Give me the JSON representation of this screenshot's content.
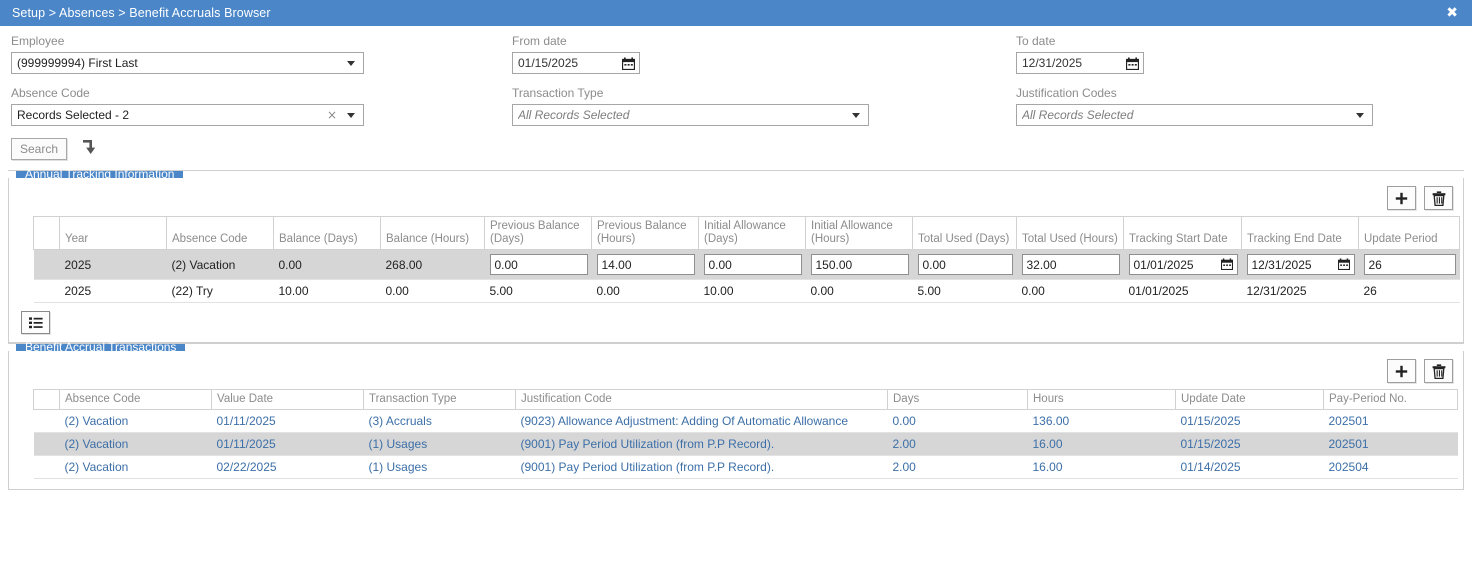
{
  "titlebar": {
    "breadcrumb": "Setup > Absences > Benefit Accruals Browser",
    "close_label": "✖"
  },
  "filters": {
    "employee": {
      "label": "Employee",
      "value": "(999999994) First Last"
    },
    "absence_code": {
      "label": "Absence Code",
      "value": "Records Selected - 2",
      "clear_label": "×"
    },
    "from_date": {
      "label": "From date",
      "value": "01/15/2025"
    },
    "to_date": {
      "label": "To date",
      "value": "12/31/2025"
    },
    "transaction_type": {
      "label": "Transaction Type",
      "placeholder": "All Records Selected"
    },
    "justification_codes": {
      "label": "Justification Codes",
      "placeholder": "All Records Selected"
    },
    "search_button": "Search"
  },
  "annual_tracking": {
    "panel_title": "Annual Tracking Information",
    "toolbar": {
      "add_label": "+",
      "delete_label": "🗑"
    },
    "columns": [
      "",
      "Year",
      "Absence Code",
      "Balance (Days)",
      "Balance (Hours)",
      "Previous Balance (Days)",
      "Previous Balance (Hours)",
      "Initial Allowance (Days)",
      "Initial Allowance (Hours)",
      "Total Used (Days)",
      "Total Used (Hours)",
      "Tracking Start Date",
      "Tracking End Date",
      "Update Period"
    ],
    "rows": [
      {
        "selected": true,
        "editable": true,
        "year": "2025",
        "absence_code": "(2) Vacation",
        "balance_days": "0.00",
        "balance_hours": "268.00",
        "previous_balance_days": "0.00",
        "previous_balance_hours": "14.00",
        "initial_allowance_days": "0.00",
        "initial_allowance_hours": "150.00",
        "total_used_days": "0.00",
        "total_used_hours": "32.00",
        "tracking_start_date": "01/01/2025",
        "tracking_end_date": "12/31/2025",
        "update_period": "26"
      },
      {
        "selected": false,
        "editable": false,
        "year": "2025",
        "absence_code": "(22) Try",
        "balance_days": "10.00",
        "balance_hours": "0.00",
        "previous_balance_days": "5.00",
        "previous_balance_hours": "0.00",
        "initial_allowance_days": "10.00",
        "initial_allowance_hours": "0.00",
        "total_used_days": "5.00",
        "total_used_hours": "0.00",
        "tracking_start_date": "01/01/2025",
        "tracking_end_date": "12/31/2025",
        "update_period": "26"
      }
    ]
  },
  "transactions": {
    "panel_title": "Benefit Accrual Transactions",
    "toolbar": {
      "add_label": "+",
      "delete_label": "🗑"
    },
    "columns": [
      "",
      "Absence Code",
      "Value Date",
      "Transaction Type",
      "Justification Code",
      "Days",
      "Hours",
      "Update Date",
      "Pay-Period No."
    ],
    "rows": [
      {
        "selected": false,
        "absence_code": "(2) Vacation",
        "value_date": "01/11/2025",
        "transaction_type": "(3) Accruals",
        "justification_code": "(9023) Allowance Adjustment: Adding Of Automatic Allowance",
        "days": "0.00",
        "hours": "136.00",
        "update_date": "01/15/2025",
        "pay_period_no": "202501"
      },
      {
        "selected": true,
        "absence_code": "(2) Vacation",
        "value_date": "01/11/2025",
        "transaction_type": "(1) Usages",
        "justification_code": "(9001) Pay Period Utilization (from P.P Record).",
        "days": "2.00",
        "hours": "16.00",
        "update_date": "01/15/2025",
        "pay_period_no": "202501"
      },
      {
        "selected": false,
        "absence_code": "(2) Vacation",
        "value_date": "02/22/2025",
        "transaction_type": "(1) Usages",
        "justification_code": "(9001) Pay Period Utilization (from P.P Record).",
        "days": "2.00",
        "hours": "16.00",
        "update_date": "01/14/2025",
        "pay_period_no": "202504"
      }
    ]
  },
  "colors": {
    "accent": "#4a86c8",
    "link": "#3c6fa8",
    "selected_row": "#d6d6d6",
    "label": "#8c8c8c"
  }
}
